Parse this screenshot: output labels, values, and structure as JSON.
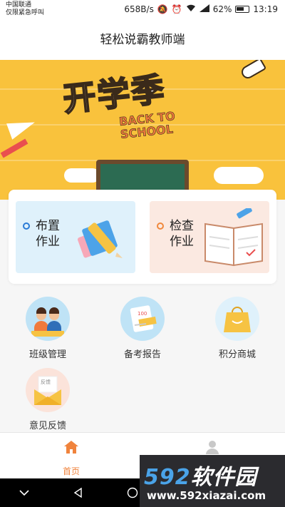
{
  "status_bar": {
    "carrier": "中国联通",
    "emergency": "仅限紧急呼叫",
    "speed": "658B/s",
    "battery": "62%",
    "time": "13:19"
  },
  "header": {
    "title": "轻松说霸教师端"
  },
  "banner": {
    "title": "开学季",
    "subtitle_line1": "BACK TO",
    "subtitle_line2": "SCHOOL"
  },
  "primary_actions": [
    {
      "label": "布置作业",
      "accent": "#2a7bd6",
      "bg": "#dff1fb"
    },
    {
      "label": "检查作业",
      "accent": "#f0883c",
      "bg": "#fbe9e1"
    }
  ],
  "grid": [
    {
      "label": "班级管理",
      "icon": "class-management-icon"
    },
    {
      "label": "备考报告",
      "icon": "exam-report-icon"
    },
    {
      "label": "积分商城",
      "icon": "points-mall-icon"
    },
    {
      "label": "意见反馈",
      "icon": "feedback-icon"
    }
  ],
  "tabbar": {
    "home_label": "首页",
    "active_color": "#f0833c"
  },
  "watermark": {
    "brand_num": "592",
    "brand_text": "软件园",
    "url": "www.592xiazai.com"
  }
}
